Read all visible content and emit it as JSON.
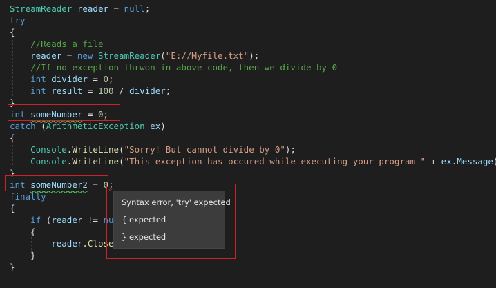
{
  "code_lines": [
    "StreamReader reader = null;",
    "try",
    "{",
    "    //Reads a file",
    "    reader = new StreamReader(\"E://Myfile.txt\");",
    "    //If no exception thrwon in above code, then we divide by 0",
    "    int divider = 0;",
    "    int result = 100 / divider;",
    "}",
    "int someNumber = 0;",
    "catch (ArithmeticException ex)",
    "{",
    "    Console.WriteLine(\"Sorry! But cannot divide by 0\");",
    "    Console.WriteLine(\"This exception has occured while executing your program \" + ex.Message);",
    "}",
    "int someNumber2 = 0;",
    "finally",
    "{",
    "    if (reader != null)",
    "    {",
    "        reader.Close();",
    "    }",
    "}"
  ],
  "tooltip": {
    "lines": [
      "Syntax error, 'try' expected",
      "{ expected",
      "} expected"
    ]
  },
  "colors": {
    "background": "#1e1e1e",
    "keyword": "#569cd6",
    "type": "#4ec9b0",
    "comment": "#57a64a",
    "string": "#d69d85",
    "number": "#b5cea8",
    "method": "#dcdcaa",
    "highlight_box": "#d0202a",
    "tooltip_bg": "#3c3c3c"
  }
}
